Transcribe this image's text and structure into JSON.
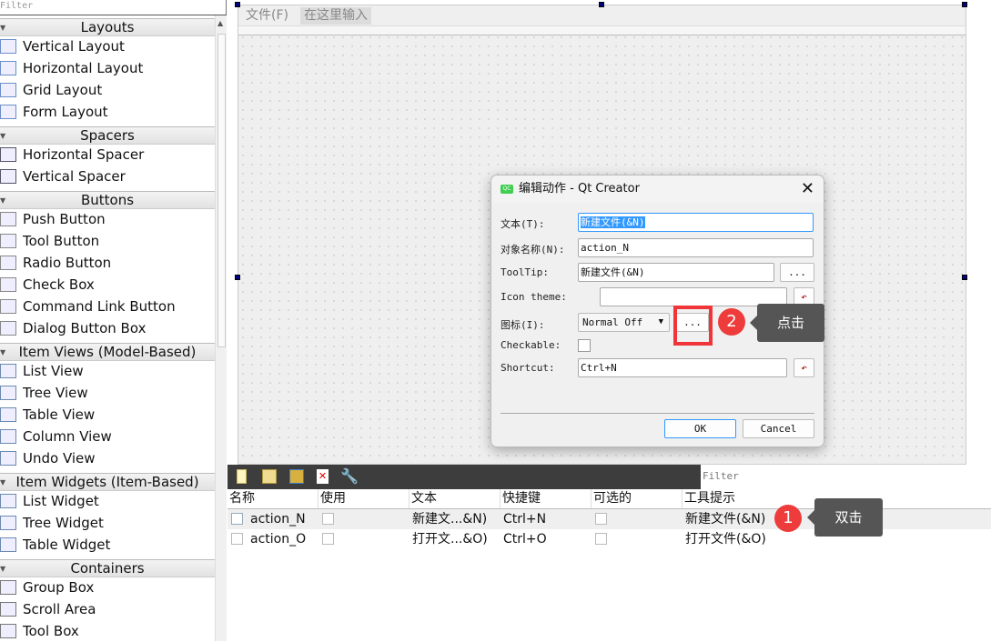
{
  "widget_box": {
    "filter_placeholder": "Filter",
    "categories": [
      {
        "label": "Layouts",
        "items": [
          "Vertical Layout",
          "Horizontal Layout",
          "Grid Layout",
          "Form Layout"
        ]
      },
      {
        "label": "Spacers",
        "items": [
          "Horizontal Spacer",
          "Vertical Spacer"
        ]
      },
      {
        "label": "Buttons",
        "items": [
          "Push Button",
          "Tool Button",
          "Radio Button",
          "Check Box",
          "Command Link Button",
          "Dialog Button Box"
        ]
      },
      {
        "label": "Item Views (Model-Based)",
        "items": [
          "List View",
          "Tree View",
          "Table View",
          "Column View",
          "Undo View"
        ]
      },
      {
        "label": "Item Widgets (Item-Based)",
        "items": [
          "List Widget",
          "Tree Widget",
          "Table Widget"
        ]
      },
      {
        "label": "Containers",
        "items": [
          "Group Box",
          "Scroll Area",
          "Tool Box"
        ]
      }
    ]
  },
  "form": {
    "menu": [
      "文件(F)",
      "在这里输入"
    ]
  },
  "action_editor": {
    "filter_placeholder": "Filter",
    "toolbar_icons": [
      "new-action-icon",
      "copy-action-icon",
      "paste-action-icon",
      "delete-action-icon",
      "configure-icon"
    ],
    "columns": [
      "名称",
      "使用",
      "文本",
      "快捷键",
      "可选的",
      "工具提示"
    ],
    "rows": [
      {
        "name": "action_N",
        "text": "新建文...&N)",
        "shortcut": "Ctrl+N",
        "tooltip": "新建文件(&N)"
      },
      {
        "name": "action_O",
        "text": "打开文...&O)",
        "shortcut": "Ctrl+O",
        "tooltip": "打开文件(&O)"
      }
    ]
  },
  "dialog": {
    "title": "编辑动作 - Qt Creator",
    "text_label": "文本(T):",
    "text_value": "新建文件(&N)",
    "object_label": "对象名称(N):",
    "object_value": "action_N",
    "tooltip_label": "ToolTip:",
    "tooltip_value": "新建文件(&N)",
    "icon_theme_label": "Icon theme:",
    "icon_theme_value": "",
    "icon_label": "图标(I):",
    "icon_mode": "Normal Off",
    "checkable_label": "Checkable:",
    "shortcut_label": "Shortcut:",
    "shortcut_value": "Ctrl+N",
    "ellipsis": "...",
    "ok": "OK",
    "cancel": "Cancel"
  },
  "annotations": [
    {
      "number": "1",
      "text": "双击"
    },
    {
      "number": "2",
      "text": "点击"
    }
  ],
  "colors": {
    "highlight": "#f0353a",
    "selection": "#3399ff"
  }
}
